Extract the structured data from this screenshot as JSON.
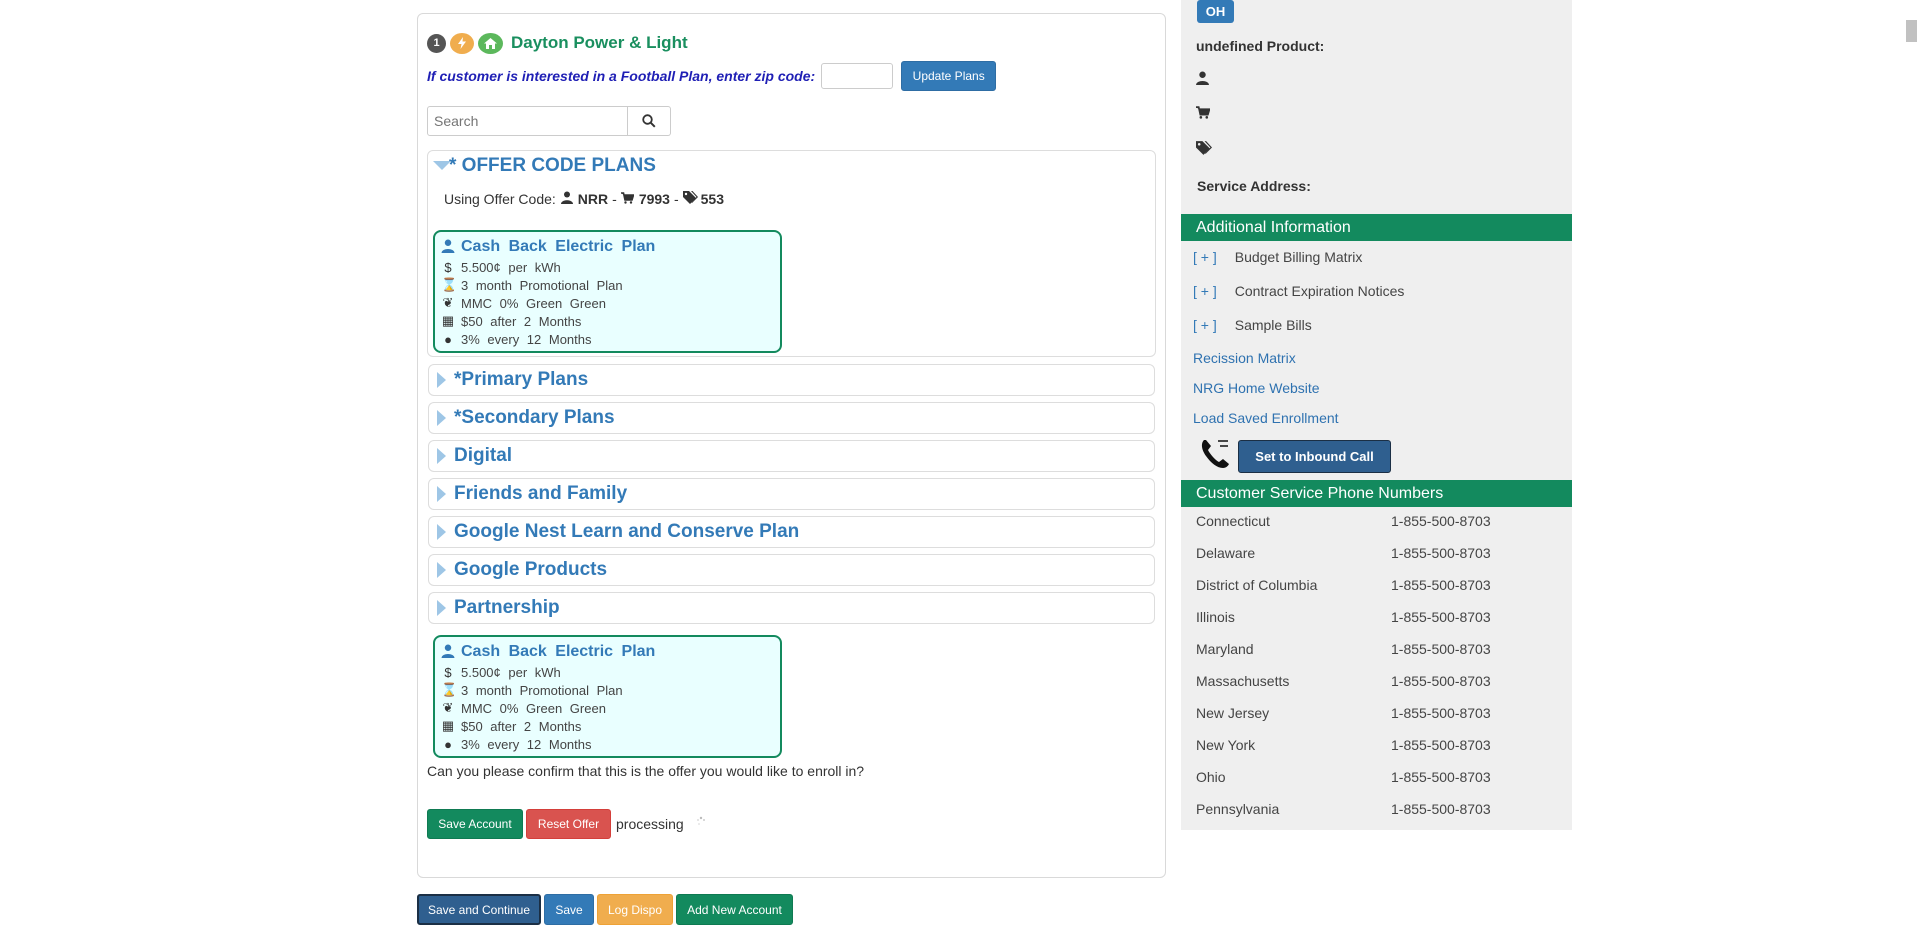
{
  "header": {
    "step_number": "1",
    "utility_name": "Dayton Power & Light",
    "zip_prompt": "If customer is interested in a Football Plan, enter zip code:",
    "zip_value": "",
    "update_button": "Update Plans"
  },
  "search": {
    "placeholder": "Search"
  },
  "offer_section": {
    "title": "* OFFER CODE PLANS",
    "using_label": "Using Offer Code:",
    "code_user": "NRR",
    "code_cart": "7993",
    "code_tag": "553",
    "sep": "-"
  },
  "plan": {
    "title": "Cash Back Electric Plan",
    "rate": "5.500¢ per kWh",
    "term": "3 month Promotional Plan",
    "green": "MMC 0% Green Green",
    "reward": "$50 after 2 Months",
    "cashback": "3% every 12 Months"
  },
  "categories": [
    "*Primary Plans",
    "*Secondary Plans",
    "Digital",
    "Friends and Family",
    "Google Nest Learn and Conserve Plan",
    "Google Products",
    "Partnership"
  ],
  "confirm_text": "Can you please confirm that this is the offer you would like to enroll in?",
  "actions": {
    "save_account": "Save Account",
    "reset_offer": "Reset Offer",
    "processing": "processing"
  },
  "bottom_buttons": {
    "save_continue": "Save and Continue",
    "save": "Save",
    "log_dispo": "Log Dispo",
    "add_account": "Add New Account"
  },
  "sidebar": {
    "state": "OH",
    "product_label": "undefined Product:",
    "service_address_label": "Service Address:",
    "additional_info_title": "Additional Information",
    "plus": "[ + ]",
    "expandables": [
      "Budget Billing Matrix",
      "Contract Expiration Notices",
      "Sample Bills"
    ],
    "links": [
      "Recission Matrix",
      "NRG Home Website",
      "Load Saved Enrollment"
    ],
    "inbound_button": "Set to Inbound Call",
    "phones_title": "Customer Service Phone Numbers",
    "phones": [
      {
        "state": "Connecticut",
        "number": "1-855-500-8703"
      },
      {
        "state": "Delaware",
        "number": "1-855-500-8703"
      },
      {
        "state": "District of Columbia",
        "number": "1-855-500-8703"
      },
      {
        "state": "Illinois",
        "number": "1-855-500-8703"
      },
      {
        "state": "Maryland",
        "number": "1-855-500-8703"
      },
      {
        "state": "Massachusetts",
        "number": "1-855-500-8703"
      },
      {
        "state": "New Jersey",
        "number": "1-855-500-8703"
      },
      {
        "state": "New York",
        "number": "1-855-500-8703"
      },
      {
        "state": "Ohio",
        "number": "1-855-500-8703"
      },
      {
        "state": "Pennsylvania",
        "number": "1-855-500-8703"
      }
    ]
  },
  "colors": {
    "green": "#138a5e",
    "blue": "#337ab7",
    "red": "#d9534f",
    "orange": "#f0ad4e"
  }
}
